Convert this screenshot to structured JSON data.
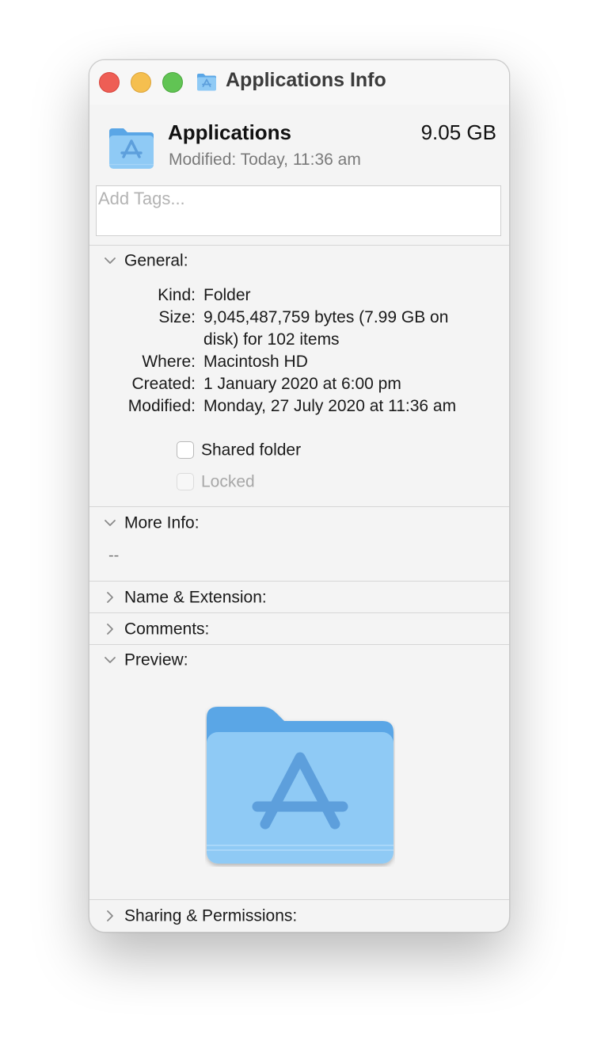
{
  "window": {
    "title": "Applications Info"
  },
  "header": {
    "name": "Applications",
    "size": "9.05 GB",
    "modified": "Modified: Today, 11:36 am"
  },
  "tags": {
    "placeholder": "Add Tags..."
  },
  "general": {
    "label": "General:",
    "kind_label": "Kind:",
    "kind_value": "Folder",
    "size_label": "Size:",
    "size_value_line1": "9,045,487,759 bytes (7.99 GB on",
    "size_value_line2": "disk) for 102 items",
    "where_label": "Where:",
    "where_value": "Macintosh HD",
    "created_label": "Created:",
    "created_value": "1 January 2020 at 6:00 pm",
    "modified_label": "Modified:",
    "modified_value": "Monday, 27 July 2020 at 11:36 am",
    "shared_folder_label": "Shared folder",
    "shared_folder_checked": false,
    "locked_label": "Locked",
    "locked_checked": false,
    "locked_enabled": false
  },
  "more_info": {
    "label": "More Info:",
    "value": "--"
  },
  "name_extension": {
    "label": "Name & Extension:"
  },
  "comments": {
    "label": "Comments:"
  },
  "preview": {
    "label": "Preview:"
  },
  "sharing": {
    "label": "Sharing & Permissions:"
  },
  "colors": {
    "close": "#ee5e55",
    "minimize": "#f5bf4f",
    "maximize": "#61c454",
    "folder_front": "#8fcaf5",
    "folder_back": "#5aa6e6",
    "folder_symbol": "#5d9fdc"
  },
  "icons": {
    "title_icon": "applications-folder-icon",
    "header_icon": "applications-folder-icon",
    "preview_icon": "applications-folder-icon"
  }
}
